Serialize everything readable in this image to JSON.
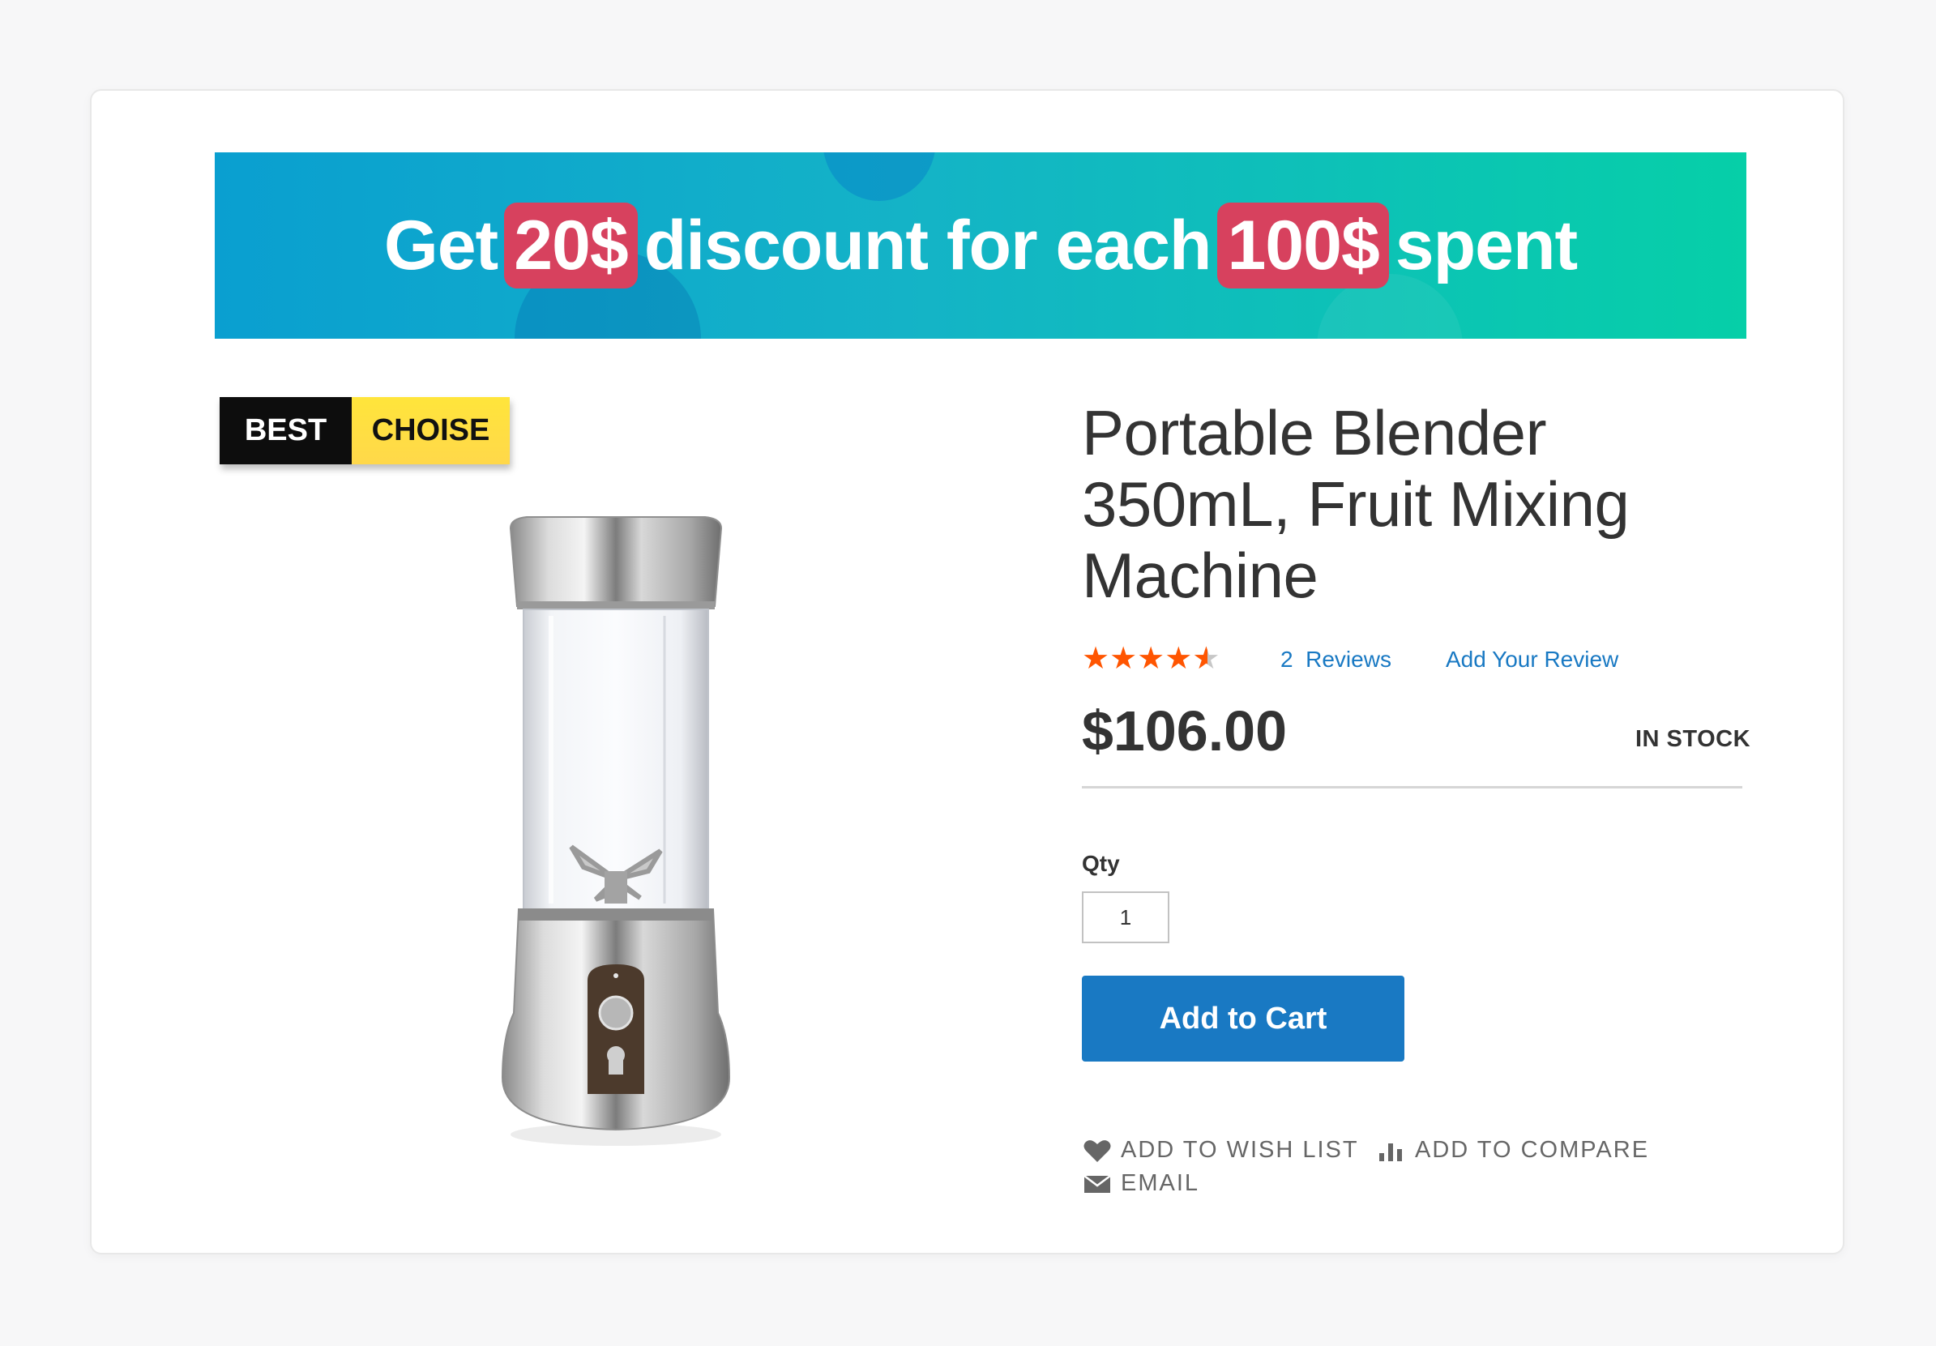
{
  "promo_banner": {
    "part1": "Get",
    "highlight1": "20$",
    "part2": "discount for each",
    "highlight2": "100$",
    "part3": "spent"
  },
  "badge": {
    "left": "BEST",
    "right": "CHOISE"
  },
  "product": {
    "title": "Portable Blender 350mL, Fruit Mixing Machine",
    "rating_value": 4.5,
    "rating_max": 5,
    "reviews_count": "2",
    "reviews_label": "Reviews",
    "add_review_label": "Add Your Review",
    "price": "$106.00",
    "stock_status": "IN STOCK"
  },
  "form": {
    "qty_label": "Qty",
    "qty_value": "1",
    "add_to_cart_label": "Add to Cart"
  },
  "actions": {
    "wishlist_label": "Add to Wish List",
    "compare_label": "Add to Compare",
    "email_label": "Email"
  },
  "colors": {
    "accent_blue": "#1979c3",
    "star_orange": "#ff5501",
    "banner_highlight": "#d7415e",
    "badge_yellow": "#ffe53b"
  }
}
